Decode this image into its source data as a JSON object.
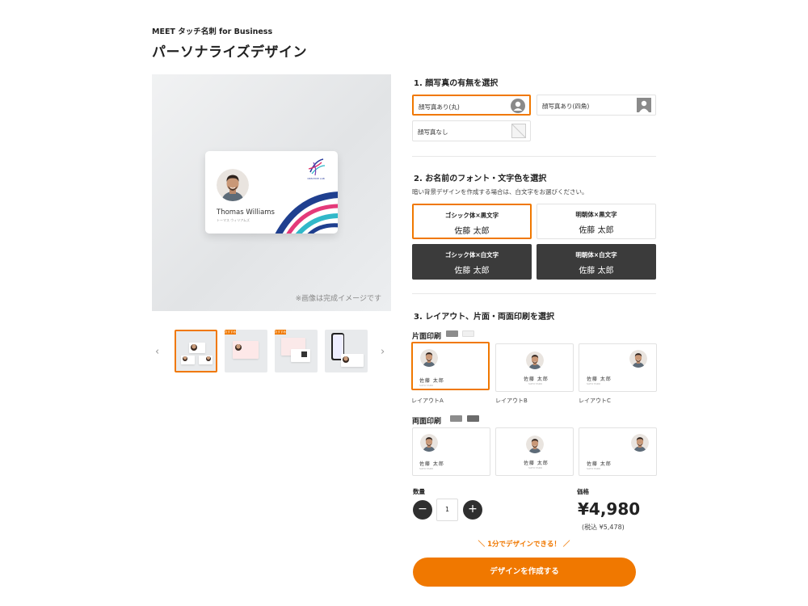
{
  "header": {
    "brand": "MEET タッチ名刺 for Business",
    "title": "パーソナライズデザイン"
  },
  "preview": {
    "note": "※画像は完成イメージです",
    "card_name": "Thomas Williams",
    "card_kana": "トーマス ウィリアムズ",
    "card_company": "CREATIVE LAB"
  },
  "thumbnails": {
    "prev_icon": "chevron-left-icon",
    "next_icon": "chevron-right-icon",
    "badge": "おすすめ"
  },
  "step1": {
    "title": "1. 顔写真の有無を選択",
    "options": [
      {
        "label": "顔写真あり(丸)",
        "icon": "circle-avatar-icon",
        "selected": true
      },
      {
        "label": "顔写真あり(四角)",
        "icon": "square-avatar-icon",
        "selected": false
      },
      {
        "label": "顔写真なし",
        "icon": "no-photo-icon",
        "selected": false
      }
    ]
  },
  "step2": {
    "title": "2. お名前のフォント・文字色を選択",
    "note": "暗い背景デザインを作成する場合は、白文字をお選びください。",
    "options": [
      {
        "title": "ゴシック体×黒文字",
        "sample": "佐藤 太郎",
        "selected": true
      },
      {
        "title": "明朝体×黒文字",
        "sample": "佐藤 太郎",
        "selected": false
      },
      {
        "title": "ゴシック体×白文字",
        "sample": "佐藤 太郎",
        "selected": false
      },
      {
        "title": "明朝体×白文字",
        "sample": "佐藤 太郎",
        "selected": false
      }
    ]
  },
  "step3": {
    "title": "3. レイアウト、片面・両面印刷を選択",
    "single_label": "片面印刷",
    "double_label": "両面印刷",
    "card_name": "佐藤 太郎",
    "card_sub": "SATO TARO",
    "layouts": [
      {
        "caption": "レイアウトA",
        "selected": true
      },
      {
        "caption": "レイアウトB",
        "selected": false
      },
      {
        "caption": "レイアウトC",
        "selected": false
      }
    ]
  },
  "order": {
    "quantity_label": "数量",
    "quantity_value": "1",
    "minus": "−",
    "plus": "+",
    "price_label": "価格",
    "price": "¥4,980",
    "price_tax": "(税込 ¥5,478)",
    "promo": "＼ 1分でデザインできる！ ／",
    "cta": "デザインを作成する"
  },
  "colors": {
    "accent": "#f07800",
    "dark_option": "#3b3b3b",
    "button_dark": "#2f2f2f"
  }
}
